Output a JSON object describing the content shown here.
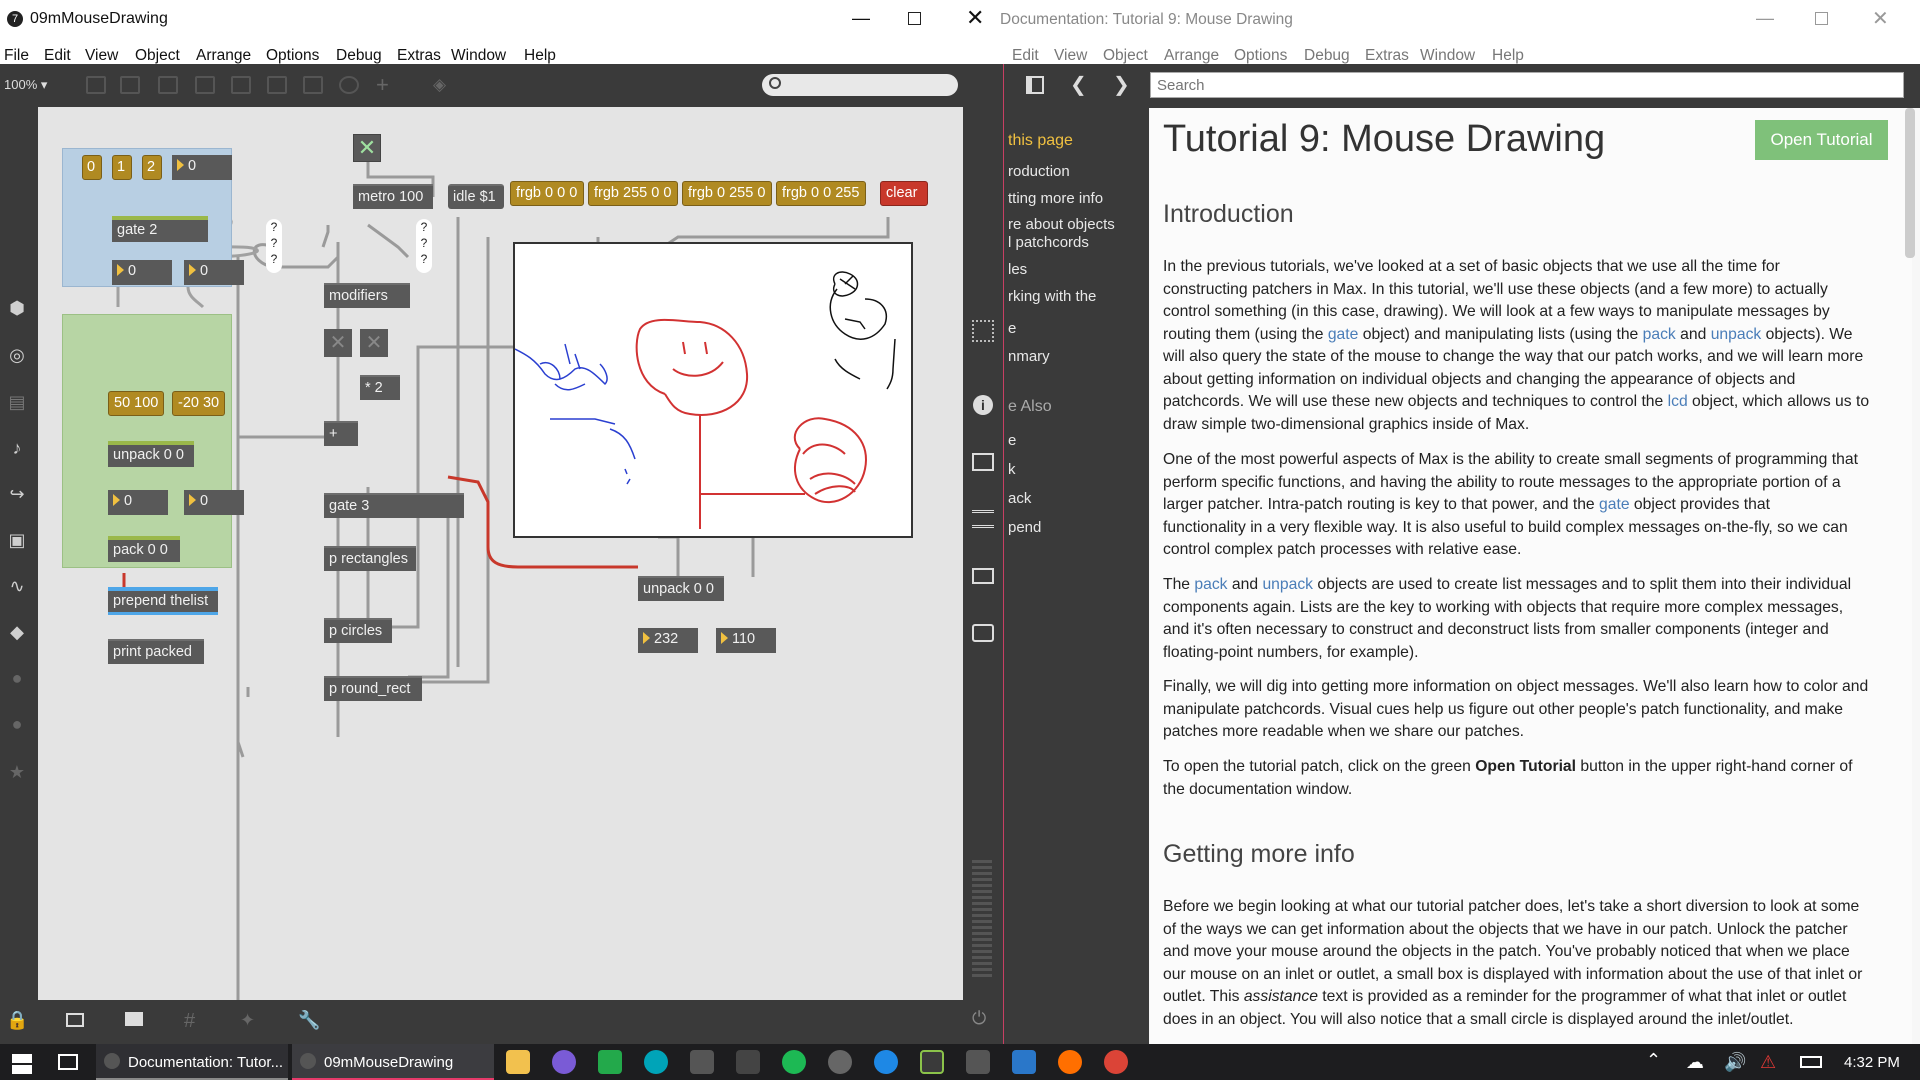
{
  "left_window": {
    "title": "09mMouseDrawing",
    "app_icon": "7",
    "menu": [
      "File",
      "Edit",
      "View",
      "Object",
      "Arrange",
      "Options",
      "Debug",
      "Extras",
      "Window",
      "Help"
    ],
    "zoom": "100% ▾"
  },
  "patch": {
    "gate_msgs": [
      "0",
      "1",
      "2"
    ],
    "gate_num": "0",
    "gate2": "gate 2",
    "gate_out1": "0",
    "gate_out2": "0",
    "pack_msg1": "50 100",
    "pack_msg2": "-20 30",
    "unpack": "unpack 0 0",
    "unpack_out1": "0",
    "unpack_out2": "0",
    "pack": "pack 0 0",
    "prepend": "prepend thelist",
    "print": "print packed",
    "metro": "metro 100",
    "idle": "idle $1",
    "frgb": [
      "frgb 0 0 0",
      "frgb 255 0 0",
      "frgb 0 255 0",
      "frgb 0 0 255"
    ],
    "clear": "clear",
    "modifiers": "modifiers",
    "mul2": "* 2",
    "plus": "+",
    "gate3": "gate 3",
    "p_rect": "p rectangles",
    "p_circ": "p circles",
    "p_round": "p round_rect",
    "unpack2": "unpack 0 0",
    "out_x": "232",
    "out_y": "110",
    "hint": "?"
  },
  "right_window": {
    "title": "Documentation: Tutorial 9: Mouse Drawing",
    "menu": [
      "Edit",
      "View",
      "Object",
      "Arrange",
      "Options",
      "Debug",
      "Extras",
      "Window",
      "Help"
    ],
    "search_placeholder": "Search"
  },
  "doc_nav": {
    "header": "this page",
    "items": [
      "roduction",
      "tting more info",
      "re about objects",
      "l patchcords",
      "les",
      "rking with the",
      "e",
      "nmary"
    ],
    "see_also": "e Also",
    "see_items": [
      "e",
      "k",
      "ack",
      "pend"
    ]
  },
  "doc": {
    "title": "Tutorial 9: Mouse Drawing",
    "open_button": "Open Tutorial",
    "h_intro": "Introduction",
    "h_more": "Getting more info",
    "p1": [
      "In the previous tutorials, we've looked at a set of basic objects that we use all the time for",
      "constructing patchers in Max. In this tutorial, we'll use these objects (and a few more) to actually",
      "control something (in this case, drawing). We will look at a few ways to manipulate messages by",
      "routing them (using the ",
      " object) and manipulating lists (using the ",
      " and ",
      " objects). We",
      "will also query the state of the mouse to change the way that our patch works, and we will learn more",
      "about getting information on individual objects and changing the appearance of objects and",
      "patchcords. We will use these new objects and techniques to control the ",
      " object, which allows us to",
      "draw simple two-dimensional graphics inside of Max."
    ],
    "links": {
      "gate": "gate",
      "pack": "pack",
      "unpack": "unpack",
      "lcd": "lcd"
    },
    "p2": [
      "One of the most powerful aspects of Max is the ability to create small segments of programming that",
      "perform specific functions, and having the ability to route messages to the appropriate portion of a",
      "larger patcher. Intra-patch routing is key to that power, and the ",
      " object provides that",
      "functionality in a very flexible way.  It is also useful to build complex messages on-the-fly, so we can",
      "control complex patch processes with relative ease."
    ],
    "p3": [
      "The ",
      " and ",
      " objects are used to create list messages and to split them into their individual",
      "components again. Lists are the key to working with objects that require more complex messages,",
      "and it's often necessary to construct and deconstruct lists from smaller components (integer and",
      "floating-point numbers, for example)."
    ],
    "p4": [
      "Finally, we will dig into getting more information on object messages. We'll also learn how to color and",
      "manipulate patchcords. Visual cues help us figure out other people's patch functionality, and make",
      "patches more readable when we share our patches."
    ],
    "p5a": "To open the tutorial patch, click on the green ",
    "p5b": "Open Tutorial",
    "p5c": " button in the upper right-hand corner of",
    "p5d": "the documentation window.",
    "p6": [
      "Before we begin looking at what our tutorial patcher does, let's take a short diversion to look at some",
      "of the ways we can get information about the objects that we have in our patch. Unlock the patcher",
      "and move your mouse around the objects in the patch. You've probably noticed that when we place",
      "our mouse on an inlet or outlet, a small box is displayed with information about the use of that inlet or",
      "outlet. This ",
      " text is provided as a reminder for the programmer of what that inlet or outlet",
      "does in an object. You will also notice that a small circle is displayed around the inlet/outlet."
    ],
    "assistance": "assistance"
  },
  "taskbar": {
    "task1": "Documentation: Tutor...",
    "task2": "09mMouseDrawing",
    "time": "4:32 PM"
  }
}
